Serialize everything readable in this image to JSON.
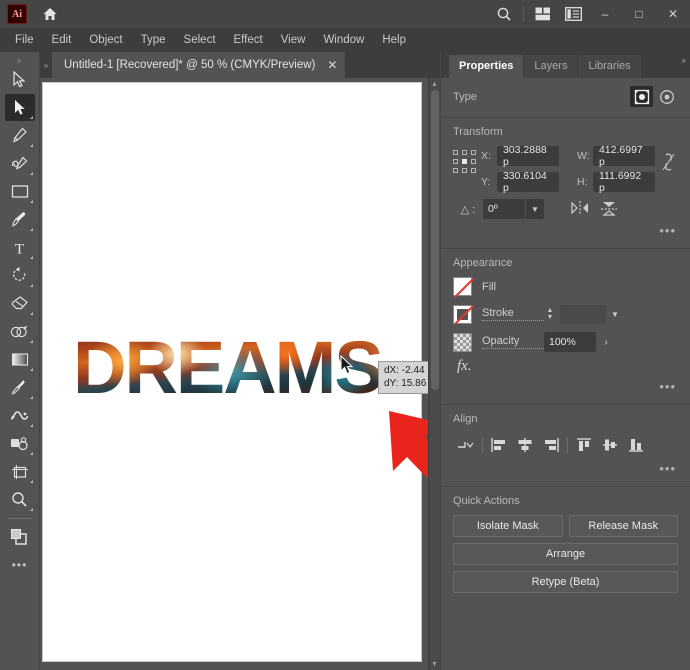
{
  "app": {
    "name": "Adobe Illustrator",
    "logo_text": "Ai"
  },
  "titlebar": {
    "home_icon": "home-icon",
    "search_icon": "search-icon",
    "arrange_documents_icon": "arrange-documents-icon",
    "workspace_switcher_icon": "workspace-switcher-icon",
    "minimize_label": "–",
    "maximize_label": "□",
    "close_label": "✕"
  },
  "menubar": {
    "items": [
      {
        "label": "File"
      },
      {
        "label": "Edit"
      },
      {
        "label": "Object"
      },
      {
        "label": "Type"
      },
      {
        "label": "Select"
      },
      {
        "label": "Effect"
      },
      {
        "label": "View"
      },
      {
        "label": "Window"
      },
      {
        "label": "Help"
      }
    ]
  },
  "toolbar": {
    "grip": "»",
    "tools": [
      {
        "name": "selection-tool",
        "active": false
      },
      {
        "name": "direct-selection-tool",
        "active": true
      },
      {
        "name": "pen-tool",
        "active": false
      },
      {
        "name": "curvature-tool",
        "active": false
      },
      {
        "name": "rectangle-tool",
        "active": false
      },
      {
        "name": "paintbrush-tool",
        "active": false
      },
      {
        "name": "type-tool",
        "active": false
      },
      {
        "name": "rotate-tool",
        "active": false
      },
      {
        "name": "eraser-tool",
        "active": false
      },
      {
        "name": "shape-builder-tool",
        "active": false
      },
      {
        "name": "gradient-tool",
        "active": false
      },
      {
        "name": "eyedropper-tool",
        "active": false
      },
      {
        "name": "blend-tool",
        "active": false
      },
      {
        "name": "symbol-sprayer-tool",
        "active": false
      },
      {
        "name": "artboard-tool",
        "active": false
      },
      {
        "name": "zoom-tool",
        "active": false
      }
    ],
    "fill_stroke_name": "fill-stroke-indicator",
    "more_tools_label": "•••"
  },
  "document": {
    "tab_title": "Untitled-1 [Recovered]* @ 50 % (CMYK/Preview)",
    "tab_close": "✕",
    "left_grip": "»",
    "artwork_text": "DREAMS"
  },
  "measurement_tooltip": {
    "dx": "dX: -2.44",
    "dy": "dY: 15.86"
  },
  "annotation": {
    "arrow_color": "#e8241c",
    "arrow_name": "red-annotation-arrow"
  },
  "panel": {
    "grip": "»",
    "tabs": [
      {
        "label": "Properties",
        "active": true
      },
      {
        "label": "Layers",
        "active": false
      },
      {
        "label": "Libraries",
        "active": false
      }
    ],
    "type": {
      "title": "Type",
      "icons": [
        {
          "name": "clipping-mask-icon",
          "selected": true
        },
        {
          "name": "opacity-mask-icon",
          "selected": false
        }
      ]
    },
    "transform": {
      "title": "Transform",
      "reference_point": "center",
      "x_label": "X:",
      "x_value": "303.2888 p",
      "y_label": "Y:",
      "y_value": "330.6104 p",
      "w_label": "W:",
      "w_value": "412.6997 p",
      "h_label": "H:",
      "h_value": "111.6992 p",
      "link_icon": "constrain-proportions-icon",
      "rotate_label": "△ :",
      "rotate_value": "0º",
      "flip_horizontal_icon": "flip-horizontal-icon",
      "flip_vertical_icon": "flip-vertical-icon",
      "more_label": "•••"
    },
    "appearance": {
      "title": "Appearance",
      "fill_label": "Fill",
      "fill_value": "None",
      "stroke_label": "Stroke",
      "stroke_value": "None",
      "stroke_weight": "",
      "opacity_label": "Opacity",
      "opacity_value": "100%",
      "fx_label": "fx.",
      "more_label": "•••"
    },
    "align": {
      "title": "Align",
      "align_to_icon": "align-to-selection-icon",
      "buttons": [
        {
          "name": "align-left-icon"
        },
        {
          "name": "align-horizontal-center-icon"
        },
        {
          "name": "align-right-icon"
        },
        {
          "name": "align-top-icon"
        },
        {
          "name": "align-vertical-center-icon"
        },
        {
          "name": "align-bottom-icon"
        }
      ],
      "more_label": "•••"
    },
    "quick_actions": {
      "title": "Quick Actions",
      "isolate_mask": "Isolate Mask",
      "release_mask": "Release Mask",
      "arrange": "Arrange",
      "retype": "Retype (Beta)"
    }
  }
}
